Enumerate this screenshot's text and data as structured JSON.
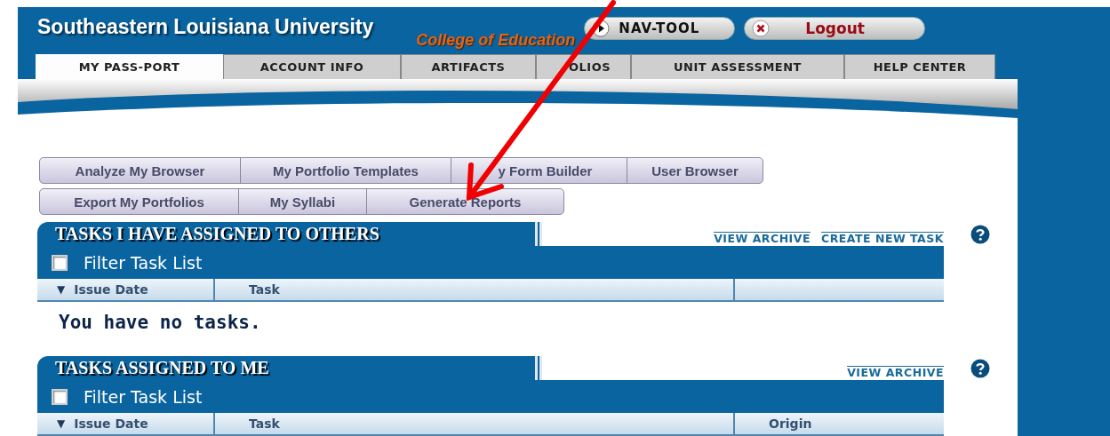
{
  "header": {
    "title": "Southeastern Louisiana University",
    "subtitle": "College of Education",
    "nav_tool": "NAV-TOOL",
    "logout": "Logout"
  },
  "tabs": [
    {
      "label": "MY PASS-PORT",
      "selected": true
    },
    {
      "label": "ACCOUNT INFO",
      "selected": false
    },
    {
      "label": "ARTIFACTS",
      "selected": false
    },
    {
      "label": "OLIOS",
      "selected": false
    },
    {
      "label": "UNIT ASSESSMENT",
      "selected": false
    },
    {
      "label": "HELP CENTER",
      "selected": false
    }
  ],
  "toolbar_rows": [
    [
      "Analyze My Browser",
      "My Portfolio Templates",
      "y Form Builder",
      "User Browser"
    ],
    [
      "Export My Portfolios",
      "My Syllabi",
      "Generate Reports"
    ]
  ],
  "sections": [
    {
      "title": "TASKS I HAVE ASSIGNED TO OTHERS",
      "links": [
        "VIEW ARCHIVE",
        "CREATE NEW TASK"
      ],
      "filter": {
        "label": "Filter Task List",
        "checked": false
      },
      "columns": [
        {
          "label": "Issue Date",
          "sort": "▼"
        },
        {
          "label": "Task"
        }
      ],
      "empty_message": "You have no tasks."
    },
    {
      "title": "TASKS ASSIGNED TO ME",
      "links": [
        "VIEW ARCHIVE"
      ],
      "filter": {
        "label": "Filter Task List",
        "checked": false
      },
      "columns": [
        {
          "label": "Issue Date",
          "sort": "▼"
        },
        {
          "label": "Task"
        },
        {
          "label": "Origin"
        }
      ]
    }
  ],
  "annotation": {
    "kind": "arrow"
  }
}
